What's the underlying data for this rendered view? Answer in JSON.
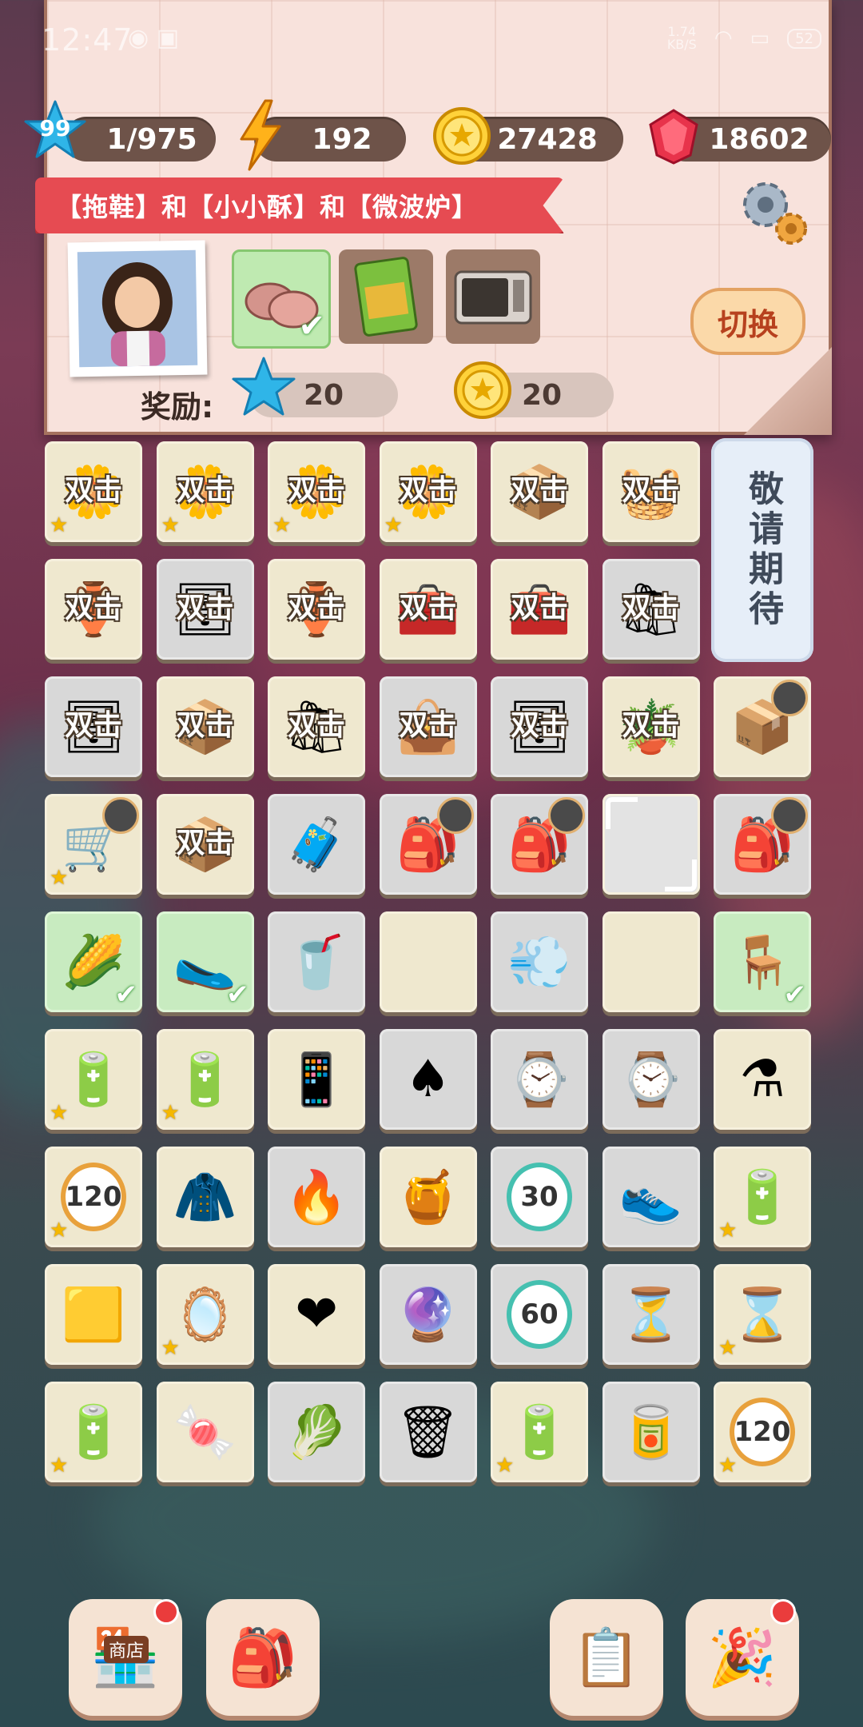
{
  "status_bar": {
    "time": "12:47",
    "net_speed": "1.74\nKB/S",
    "battery": "52"
  },
  "currencies": {
    "level": "99",
    "progress": "1/975",
    "energy": "192",
    "coins": "27428",
    "gems": "18602"
  },
  "task": {
    "title": "【拖鞋】和【小小酥】和【微波炉】",
    "switch_label": "切换",
    "reward_label": "奖励:",
    "reward_star": "20",
    "reward_coin": "20",
    "items": [
      {
        "icon": "slippers-icon",
        "done": true
      },
      {
        "icon": "snack-bag-icon",
        "done": false
      },
      {
        "icon": "microwave-icon",
        "done": false
      }
    ]
  },
  "board": {
    "double_label": "双击",
    "coming_soon": "敬请期待",
    "cells": [
      [
        "flower-pot-double",
        "flower-pot-double",
        "flower-pot-double",
        "flower-pot-double",
        "blue-box-double",
        "basket-double"
      ],
      [
        "clay-pot-double",
        "shelf-double",
        "clay-pot-double",
        "crate-double",
        "toolbox-double",
        "gift-bag-double",
        "_"
      ],
      [
        "shelf-double",
        "red-box-double",
        "shopping-bags-double",
        "red-bag-double",
        "shelf-double",
        "soil-sack-double",
        "blue-box-timer"
      ],
      [
        "cart-timer",
        "grocery-box-double",
        "wood-chest",
        "green-chest-timer",
        "green-chest-timer",
        "empty-selected",
        "green-chest-timer"
      ],
      [
        "corn",
        "slippers",
        "blender",
        "empty",
        "hair-dryer",
        "empty",
        "rocking-chair"
      ],
      [
        "energy-can",
        "batteries",
        "phone",
        "spade",
        "watch",
        "watch",
        "potion-flask"
      ],
      [
        "timer-120",
        "sweater",
        "matches",
        "honey-jar",
        "timer-30",
        "sneakers",
        "batteries"
      ],
      [
        "honeycomb",
        "magic-mirror",
        "heart",
        "hand-mirror",
        "timer-60",
        "hourglass",
        "hourglass-gold"
      ],
      [
        "batteries",
        "jelly-beans",
        "cabbage",
        "trash-can",
        "batteries",
        "glow-can",
        "timer-120"
      ]
    ]
  },
  "dock": {
    "shop_label": "商店",
    "buttons": [
      "shop-icon",
      "backpack-icon",
      "tasks-icon",
      "party-icon"
    ]
  },
  "colors": {
    "ribbon": "#e64b52",
    "panel": "#f8e2dc",
    "pill": "#6e5349",
    "accent_green": "#c8ebc0"
  }
}
